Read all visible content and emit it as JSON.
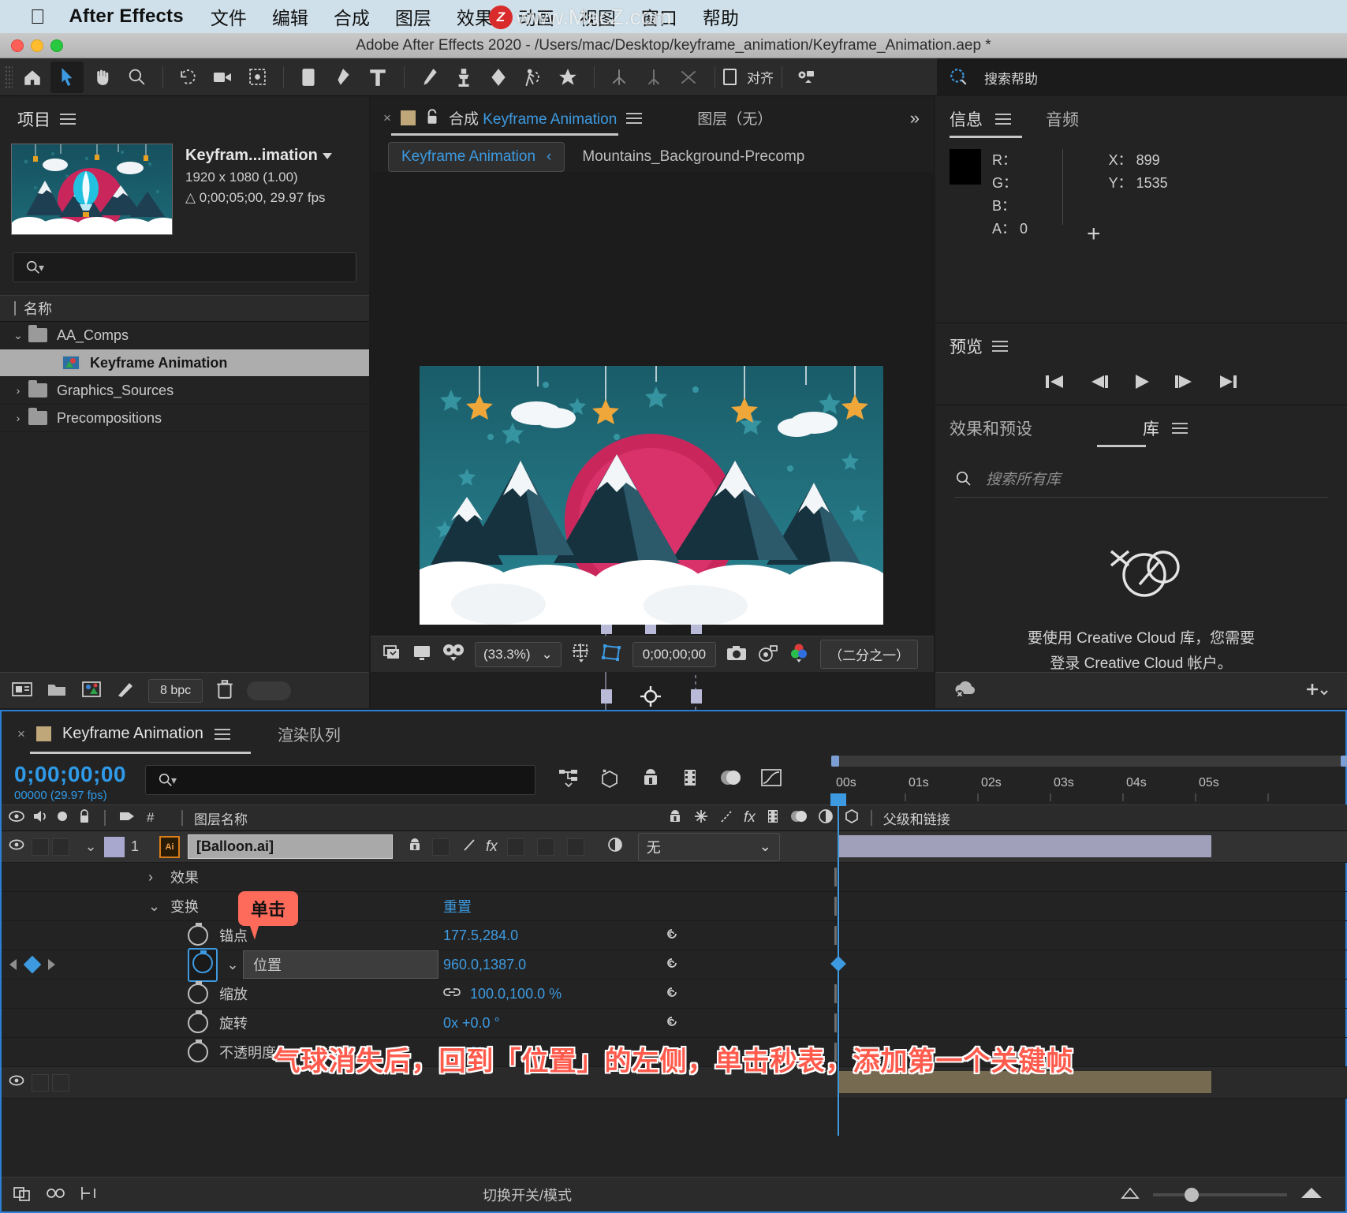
{
  "macos_menu": {
    "app_name": "After Effects",
    "items": [
      "文件",
      "编辑",
      "合成",
      "图层",
      "效果",
      "动画",
      "视图",
      "窗口",
      "帮助"
    ],
    "watermark_badge": "Z",
    "watermark_text": "www.MacZ.com"
  },
  "window": {
    "title": "Adobe After Effects 2020 - /Users/mac/Desktop/keyframe_animation/Keyframe_Animation.aep *"
  },
  "toolbar": {
    "align_label": "对齐",
    "search_help": "搜索帮助"
  },
  "project": {
    "panel_title": "项目",
    "comp_name": "Keyfram...imation",
    "resolution": "1920 x 1080 (1.00)",
    "duration": "△ 0;00;05;00, 29.97 fps",
    "search_placeholder": "",
    "column_header": "名称",
    "items": [
      {
        "label": "AA_Comps",
        "type": "folder",
        "expanded": true,
        "selected": false,
        "indent": 0
      },
      {
        "label": "Keyframe Animation",
        "type": "comp",
        "expanded": false,
        "selected": true,
        "indent": 1
      },
      {
        "label": "Graphics_Sources",
        "type": "folder",
        "expanded": false,
        "selected": false,
        "indent": 0
      },
      {
        "label": "Precompositions",
        "type": "folder",
        "expanded": false,
        "selected": false,
        "indent": 0
      }
    ],
    "bit_depth": "8 bpc"
  },
  "composition": {
    "tab_prefix": "合成",
    "tab_name": "Keyframe Animation",
    "layer_tab": "图层（无）",
    "breadcrumb_active": "Keyframe Animation",
    "breadcrumb_next": "Mountains_Background-Precomp",
    "zoom_level": "(33.3%)",
    "timecode": "0;00;00;00",
    "resolution_label": "（二分之一）"
  },
  "info_panel": {
    "tab_info": "信息",
    "tab_audio": "音频",
    "r_label": "R：",
    "g_label": "G：",
    "b_label": "B：",
    "a_label": "A：",
    "a_value": "0",
    "x_label": "X：",
    "x_value": "899",
    "y_label": "Y：",
    "y_value": "1535"
  },
  "preview_panel": {
    "title": "预览"
  },
  "effects_panel": {
    "tab_effects": "效果和预设",
    "tab_libraries": "库",
    "search_placeholder": "搜索所有库",
    "cc_message_line1": "要使用 Creative Cloud 库，您需要",
    "cc_message_line2": "登录 Creative Cloud 帐户。"
  },
  "timeline": {
    "tab_name": "Keyframe Animation",
    "tab_render_queue": "渲染队列",
    "current_time": "0;00;00;00",
    "frame_info": "00000 (29.97 fps)",
    "search_placeholder": "",
    "columns": {
      "layer_name": "图层名称",
      "number": "#",
      "parent": "父级和链接"
    },
    "ruler_labels": [
      "00s",
      "01s",
      "02s",
      "03s",
      "04s",
      "05s"
    ],
    "layer": {
      "index": "1",
      "name": "[Balloon.ai]",
      "parent_value": "无",
      "source_type": "Ai"
    },
    "rows": [
      {
        "name": "效果",
        "value": "",
        "indent": 1,
        "twirl": "right",
        "stopwatch": false
      },
      {
        "name": "变换",
        "value": "重置",
        "indent": 1,
        "twirl": "down",
        "stopwatch": false
      },
      {
        "name": "锚点",
        "value": "177.5,284.0",
        "indent": 2,
        "twirl": "none",
        "stopwatch": true
      },
      {
        "name": "位置",
        "value": "960.0,1387.0",
        "indent": 2,
        "twirl": "none",
        "stopwatch": true,
        "active": true
      },
      {
        "name": "缩放",
        "value": "100.0,100.0 %",
        "indent": 2,
        "twirl": "none",
        "stopwatch": true,
        "link": true
      },
      {
        "name": "旋转",
        "value": "0x +0.0 °",
        "indent": 2,
        "twirl": "none",
        "stopwatch": true
      },
      {
        "name": "不透明度",
        "value": "100 %",
        "indent": 2,
        "twirl": "none",
        "stopwatch": true
      }
    ],
    "switch_modes_label": "切换开关/模式",
    "callout_click": "单击",
    "caption": "气球消失后，回到「位置」的左侧，单击秒表，添加第一个关键帧"
  },
  "colors": {
    "accent_blue": "#3d9ae0",
    "callout_red": "#ff6b5b",
    "caption_red": "#ff5b4d",
    "panel_bg": "#232323",
    "menubar_bg": "#cfe0ea"
  }
}
